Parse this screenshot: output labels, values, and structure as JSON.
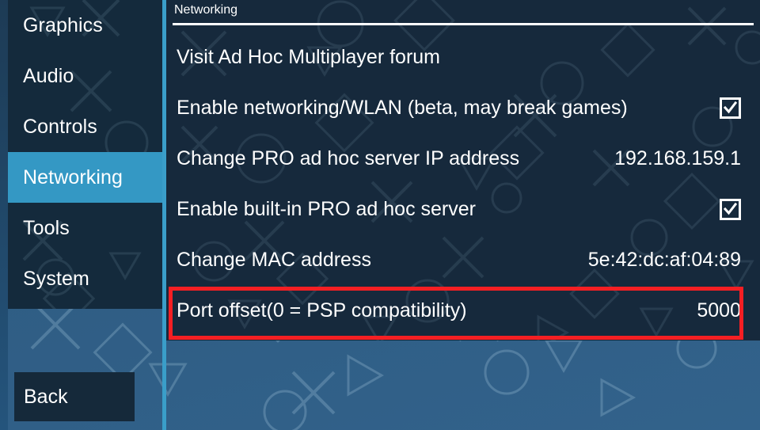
{
  "sidebar": {
    "items": [
      {
        "label": "Graphics",
        "selected": false
      },
      {
        "label": "Audio",
        "selected": false
      },
      {
        "label": "Controls",
        "selected": false
      },
      {
        "label": "Networking",
        "selected": true
      },
      {
        "label": "Tools",
        "selected": false
      },
      {
        "label": "System",
        "selected": false
      }
    ],
    "back_label": "Back"
  },
  "header": {
    "title": "Networking"
  },
  "settings_rows": [
    {
      "label": "Visit Ad Hoc Multiplayer forum",
      "type": "link",
      "value": ""
    },
    {
      "label": "Enable networking/WLAN (beta, may break games)",
      "type": "checkbox",
      "checked": true,
      "value": ""
    },
    {
      "label": "Change PRO ad hoc server IP address",
      "type": "value",
      "value": "192.168.159.1"
    },
    {
      "label": "Enable built-in PRO ad hoc server",
      "type": "checkbox",
      "checked": true,
      "value": ""
    },
    {
      "label": "Change MAC address",
      "type": "value",
      "value": "5e:42:dc:af:04:89"
    },
    {
      "label": "Port offset(0 = PSP compatibility)",
      "type": "value",
      "value": "5000",
      "highlighted": true
    }
  ],
  "colors": {
    "accent": "#3498c4",
    "panel": "#16293c",
    "sidebar": "#142a3c",
    "background": "#2e5b82",
    "annotation": "#f51f23",
    "text": "#ffffff"
  }
}
